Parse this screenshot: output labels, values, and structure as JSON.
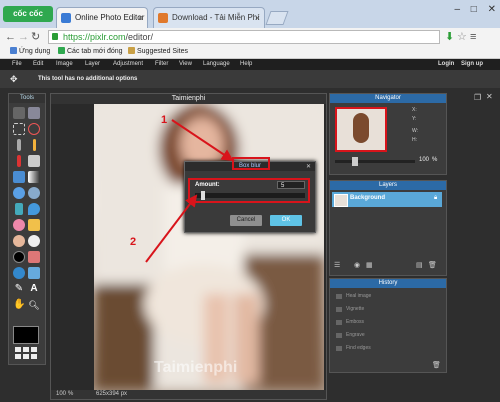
{
  "browser": {
    "logo": "cốc cốc",
    "tabs": [
      {
        "label": "Online Photo Editor | Pixlr",
        "close": "×"
      },
      {
        "label": "Download - Tải Miễn Phí",
        "close": "×"
      }
    ],
    "window_controls": [
      "–",
      "□",
      "✕"
    ],
    "url_secure": "https://pixlr.com",
    "url_path": "/editor/",
    "bookmarks": [
      "Ứng dụng",
      "Các tab mới đóng",
      "Suggested Sites"
    ]
  },
  "pixlr": {
    "menu": [
      "File",
      "Edit",
      "Image",
      "Layer",
      "Adjustment",
      "Filter",
      "View",
      "Language",
      "Help"
    ],
    "menu_right": [
      "Login",
      "Sign up"
    ],
    "options_text": "This tool has no additional options",
    "tools_title": "Tools",
    "canvas_title": "Taimienphi",
    "status_zoom": "100",
    "status_zoom_unit": "%",
    "status_size": "625x394 px",
    "watermark": "Taimienphi",
    "navigator": {
      "title": "Navigator",
      "labels": [
        "X:",
        "Y:",
        "W:",
        "H:"
      ],
      "zoom": "100",
      "zoom_unit": "%"
    },
    "layers": {
      "title": "Layers",
      "layer_name": "Background"
    },
    "history": {
      "title": "History",
      "items": [
        "Heal image",
        "Vignette",
        "Emboss",
        "Engrave",
        "Find edges"
      ]
    }
  },
  "dialog": {
    "title": "Box blur",
    "amount_label": "Amount:",
    "amount_value": "5",
    "amount_fraction": 0.05,
    "cancel": "Cancel",
    "ok": "OK"
  },
  "annotations": {
    "one": "1",
    "two": "2"
  },
  "colors": {
    "accent": "#2c6aa6",
    "ok_button": "#5fc3e6",
    "annotation_red": "#d8141b"
  }
}
